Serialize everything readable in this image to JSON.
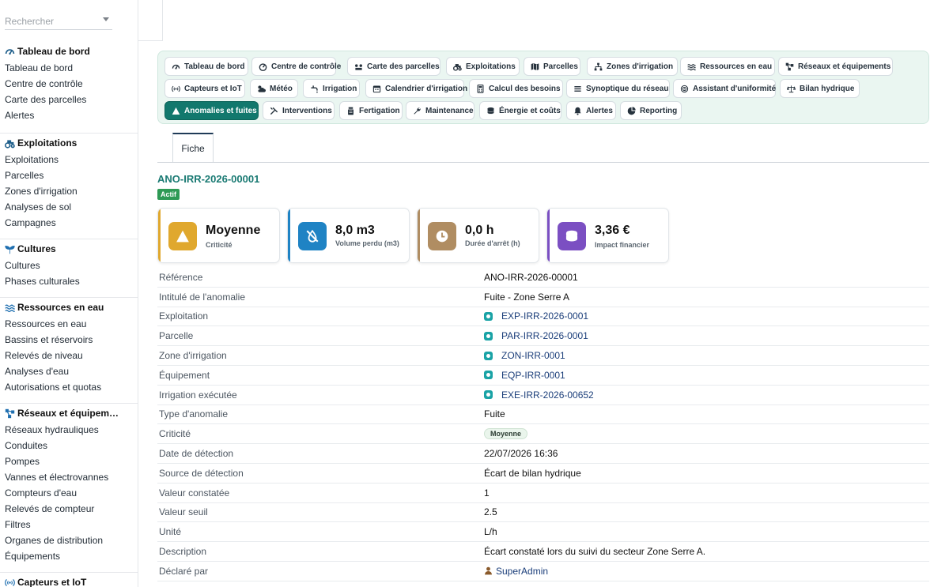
{
  "sidebar": {
    "search_placeholder": "Rechercher",
    "groups": [
      {
        "title": "Tableau de bord",
        "icon": "gauge-icon",
        "items": [
          "Tableau de bord",
          "Centre de contrôle",
          "Carte des parcelles",
          "Alertes"
        ]
      },
      {
        "title": "Exploitations",
        "icon": "tractor-icon",
        "items": [
          "Exploitations",
          "Parcelles",
          "Zones d'irrigation",
          "Analyses de sol",
          "Campagnes"
        ]
      },
      {
        "title": "Cultures",
        "icon": "seedling-icon",
        "items": [
          "Cultures",
          "Phases culturales"
        ]
      },
      {
        "title": "Ressources en eau",
        "icon": "water-icon",
        "items": [
          "Ressources en eau",
          "Bassins et réservoirs",
          "Relevés de niveau",
          "Analyses d'eau",
          "Autorisations et quotas"
        ]
      },
      {
        "title": "Réseaux et équipem…",
        "icon": "network-icon",
        "items": [
          "Réseaux hydrauliques",
          "Conduites",
          "Pompes",
          "Vannes et électrovannes",
          "Compteurs d'eau",
          "Relevés de compteur",
          "Filtres",
          "Organes de distribution",
          "Équipements"
        ]
      },
      {
        "title": "Capteurs et IoT",
        "icon": "sensor-icon",
        "items": []
      }
    ]
  },
  "module_tabs": [
    {
      "label": "Tableau de bord",
      "icon": "gauge-icon"
    },
    {
      "label": "Centre de contrôle",
      "icon": "speedometer-icon"
    },
    {
      "label": "Carte des parcelles",
      "icon": "map-pins-icon"
    },
    {
      "label": "Exploitations",
      "icon": "tractor-icon"
    },
    {
      "label": "Parcelles",
      "icon": "map-icon"
    },
    {
      "label": "Zones d'irrigation",
      "icon": "sitemap-icon"
    },
    {
      "label": "Ressources en eau",
      "icon": "water-icon"
    },
    {
      "label": "Réseaux et équipements",
      "icon": "network-icon"
    },
    {
      "label": "Capteurs et IoT",
      "icon": "sensor-icon"
    },
    {
      "label": "Météo",
      "icon": "cloud-sun-icon"
    },
    {
      "label": "Irrigation",
      "icon": "faucet-icon"
    },
    {
      "label": "Calendrier d'irrigation",
      "icon": "calendar-icon"
    },
    {
      "label": "Calcul des besoins",
      "icon": "calculator-icon"
    },
    {
      "label": "Synoptique du réseau",
      "icon": "list-icon"
    },
    {
      "label": "Assistant d'uniformité",
      "icon": "target-icon"
    },
    {
      "label": "Bilan hydrique",
      "icon": "balance-icon"
    },
    {
      "label": "Anomalies et fuites",
      "icon": "warning-icon",
      "active": true
    },
    {
      "label": "Interventions",
      "icon": "tools-icon"
    },
    {
      "label": "Fertigation",
      "icon": "flask-icon"
    },
    {
      "label": "Maintenance",
      "icon": "wrench-icon"
    },
    {
      "label": "Énergie et coûts",
      "icon": "coins-icon"
    },
    {
      "label": "Alertes",
      "icon": "bell-icon"
    },
    {
      "label": "Reporting",
      "icon": "pie-chart-icon"
    }
  ],
  "record": {
    "tab_label": "Fiche",
    "id": "ANO-IRR-2026-00001",
    "status": "Actif"
  },
  "kpis": [
    {
      "value": "Moyenne",
      "label": "Criticité",
      "icon": "warning-icon",
      "color": "#e0a82e"
    },
    {
      "value": "8,0 m3",
      "label": "Volume perdu (m3)",
      "icon": "leak-icon",
      "color": "#1f83c4"
    },
    {
      "value": "0,0 h",
      "label": "Durée d'arrêt (h)",
      "icon": "clock-icon",
      "color": "#b08d62"
    },
    {
      "value": "3,36 €",
      "label": "Impact financier",
      "icon": "coins-icon",
      "color": "#7b4fc2"
    }
  ],
  "details": [
    {
      "label": "Référence",
      "value": "ANO-IRR-2026-00001",
      "type": "text"
    },
    {
      "label": "Intitulé de l'anomalie",
      "value": "Fuite - Zone Serre A",
      "type": "text"
    },
    {
      "label": "Exploitation",
      "value": "EXP-IRR-2026-0001",
      "type": "link"
    },
    {
      "label": "Parcelle",
      "value": "PAR-IRR-2026-0001",
      "type": "link"
    },
    {
      "label": "Zone d'irrigation",
      "value": "ZON-IRR-0001",
      "type": "link"
    },
    {
      "label": "Équipement",
      "value": "EQP-IRR-0001",
      "type": "link"
    },
    {
      "label": "Irrigation exécutée",
      "value": "EXE-IRR-2026-00652",
      "type": "link"
    },
    {
      "label": "Type d'anomalie",
      "value": "Fuite",
      "type": "text"
    },
    {
      "label": "Criticité",
      "value": "Moyenne",
      "type": "pill"
    },
    {
      "label": "Date de détection",
      "value": "22/07/2026 16:36",
      "type": "text"
    },
    {
      "label": "Source de détection",
      "value": "Écart de bilan hydrique",
      "type": "text"
    },
    {
      "label": "Valeur constatée",
      "value": "1",
      "type": "text"
    },
    {
      "label": "Valeur seuil",
      "value": "2.5",
      "type": "text"
    },
    {
      "label": "Unité",
      "value": "L/h",
      "type": "text"
    },
    {
      "label": "Description",
      "value": "Écart constaté lors du suivi du secteur Zone Serre A.",
      "type": "text"
    },
    {
      "label": "Déclaré par",
      "value": "SuperAdmin",
      "type": "user"
    }
  ]
}
